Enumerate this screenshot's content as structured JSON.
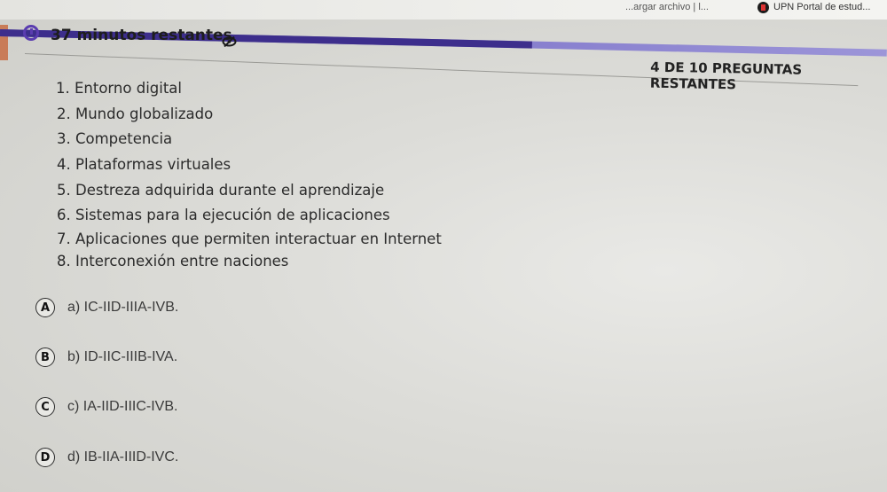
{
  "browser": {
    "prev_tab_text": "...argar archivo | l...",
    "active_tab_title": "UPN Portal de estud..."
  },
  "quiz": {
    "timer_text": "37 minutos restantes",
    "timer_icon": "timer-icon",
    "hide_icon": "eye-off-icon",
    "remaining_text": "4 DE 10 PREGUNTAS RESTANTES",
    "progress": 0.6,
    "colors": {
      "progress_fill": "#3d2e8c",
      "progress_track": "#8a82d0",
      "accent": "#c97c58"
    }
  },
  "items": [
    "1. Entorno digital",
    "2. Mundo globalizado",
    "3. Competencia",
    "4. Plataformas virtuales",
    "5. Destreza adquirida durante el aprendizaje",
    "6. Sistemas para la ejecución de aplicaciones",
    "7. Aplicaciones que permiten interactuar en Internet",
    "8. Interconexión entre naciones"
  ],
  "options": [
    {
      "letter": "A",
      "text": "a) IC-IID-IIIA-IVB."
    },
    {
      "letter": "B",
      "text": "b) ID-IIC-IIIB-IVA."
    },
    {
      "letter": "C",
      "text": "c) IA-IID-IIIC-IVB."
    },
    {
      "letter": "D",
      "text": "d) IB-IIA-IIID-IVC."
    }
  ]
}
